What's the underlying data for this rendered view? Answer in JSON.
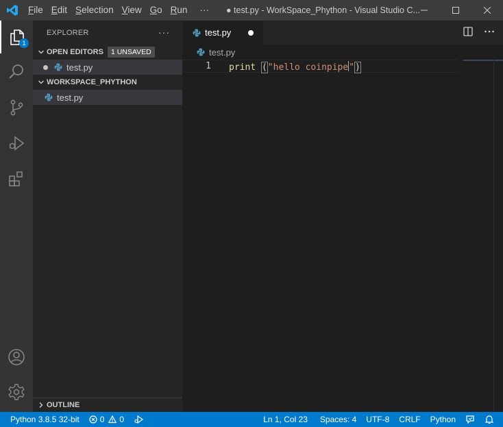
{
  "titlebar": {
    "menu": [
      {
        "mn": "F",
        "rest": "ile"
      },
      {
        "mn": "E",
        "rest": "dit"
      },
      {
        "mn": "S",
        "rest": "election"
      },
      {
        "mn": "V",
        "rest": "iew"
      },
      {
        "mn": "G",
        "rest": "o"
      },
      {
        "mn": "R",
        "rest": "un"
      }
    ],
    "more": "···",
    "title": "● test.py - WorkSpace_Phython - Visual Studio C..."
  },
  "activitybar": {
    "explorer_badge": "1"
  },
  "sidebar": {
    "header": "EXPLORER",
    "more": "···",
    "open_editors": {
      "label": "OPEN EDITORS",
      "badge": "1 UNSAVED",
      "file": "test.py"
    },
    "workspace": {
      "label": "WORKSPACE_PHYTHON",
      "file": "test.py"
    },
    "outline": "OUTLINE"
  },
  "editor": {
    "tab": {
      "label": "test.py"
    },
    "breadcrumb": "test.py",
    "lines": [
      {
        "number": "1",
        "fn": "print ",
        "open": "(",
        "string": "\"hello coinpipe",
        "string_end": "\"",
        "close": ")"
      }
    ]
  },
  "statusbar": {
    "python": "Python 3.8.5 32-bit",
    "errors": "0",
    "warnings": "0",
    "cursor_pos": "Ln 1, Col 23",
    "spaces": "Spaces: 4",
    "encoding": "UTF-8",
    "eol": "CRLF",
    "language": "Python"
  },
  "colors": {
    "accent": "#007acc",
    "titlebar": "#3c3c3c",
    "activitybar": "#333333",
    "sidebar": "#252526",
    "editor": "#1e1e1e"
  }
}
